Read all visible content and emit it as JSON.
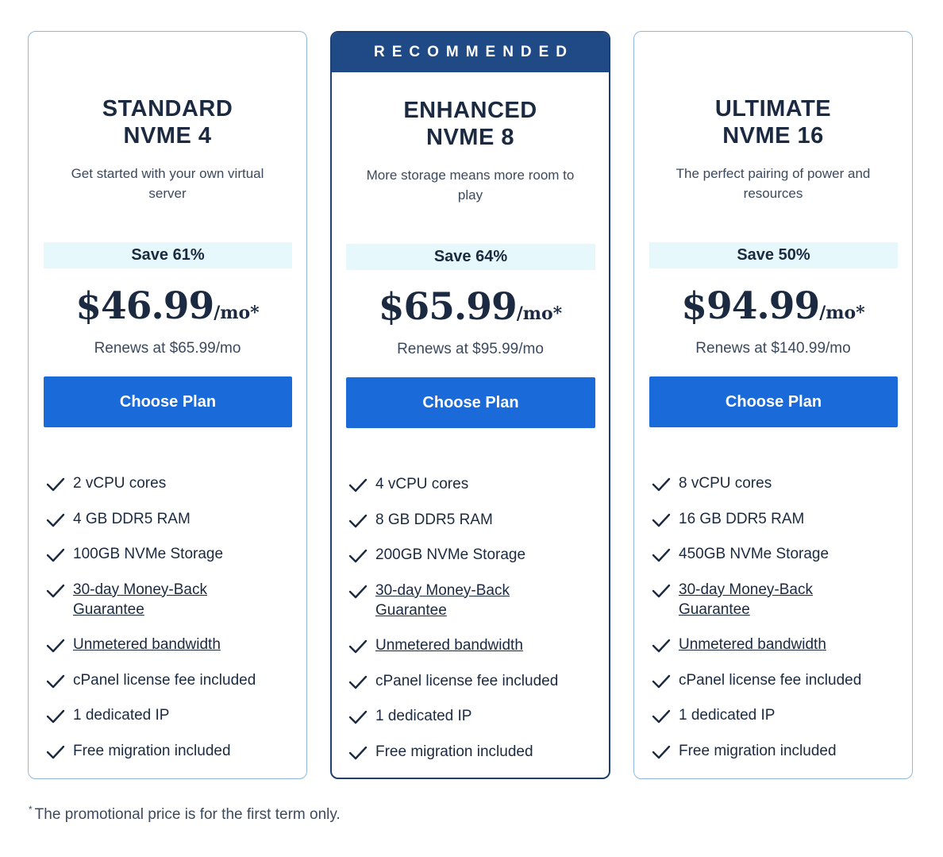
{
  "recommended_label": "RECOMMENDED",
  "plans": [
    {
      "title_line1": "STANDARD",
      "title_line2": "NVME 4",
      "description": "Get started with your own virtual server",
      "save": "Save 61%",
      "price": "$46.99",
      "per": "/mo*",
      "renews": "Renews at $65.99/mo",
      "button_label": "Choose Plan",
      "features": [
        {
          "text": "2 vCPU cores",
          "link": false
        },
        {
          "text": "4 GB DDR5 RAM",
          "link": false
        },
        {
          "text": "100GB NVMe Storage",
          "link": false
        },
        {
          "text": "30-day Money-Back Guarantee",
          "link": true
        },
        {
          "text": "Unmetered bandwidth",
          "link": true
        },
        {
          "text": "cPanel license fee included",
          "link": false
        },
        {
          "text": "1 dedicated IP",
          "link": false
        },
        {
          "text": "Free migration included",
          "link": false
        }
      ]
    },
    {
      "title_line1": "ENHANCED",
      "title_line2": "NVME 8",
      "description": "More storage means more room to play",
      "save": "Save 64%",
      "price": "$65.99",
      "per": "/mo*",
      "renews": "Renews at $95.99/mo",
      "button_label": "Choose Plan",
      "features": [
        {
          "text": "4 vCPU cores",
          "link": false
        },
        {
          "text": "8 GB DDR5 RAM",
          "link": false
        },
        {
          "text": "200GB NVMe Storage",
          "link": false
        },
        {
          "text": "30-day Money-Back Guarantee",
          "link": true
        },
        {
          "text": "Unmetered bandwidth",
          "link": true
        },
        {
          "text": "cPanel license fee included",
          "link": false
        },
        {
          "text": "1 dedicated IP",
          "link": false
        },
        {
          "text": "Free migration included",
          "link": false
        }
      ]
    },
    {
      "title_line1": "ULTIMATE",
      "title_line2": "NVME 16",
      "description": "The perfect pairing of power and resources",
      "save": "Save 50%",
      "price": "$94.99",
      "per": "/mo*",
      "renews": "Renews at $140.99/mo",
      "button_label": "Choose Plan",
      "features": [
        {
          "text": "8 vCPU cores",
          "link": false
        },
        {
          "text": "16 GB DDR5 RAM",
          "link": false
        },
        {
          "text": "450GB NVMe Storage",
          "link": false
        },
        {
          "text": "30-day Money-Back Guarantee",
          "link": true
        },
        {
          "text": "Unmetered bandwidth",
          "link": true
        },
        {
          "text": "cPanel license fee included",
          "link": false
        },
        {
          "text": "1 dedicated IP",
          "link": false
        },
        {
          "text": "Free migration included",
          "link": false
        }
      ]
    }
  ],
  "footnote": {
    "marker": "*",
    "text": "The promotional price is for the first term only."
  },
  "colors": {
    "primary_button": "#1a6ad9",
    "recommended_banner": "#1f4a86",
    "save_background": "#e6f8fc",
    "text_dark": "#1b2a40",
    "card_border": "#8fb8df"
  },
  "icons": {
    "feature": "check-icon"
  }
}
